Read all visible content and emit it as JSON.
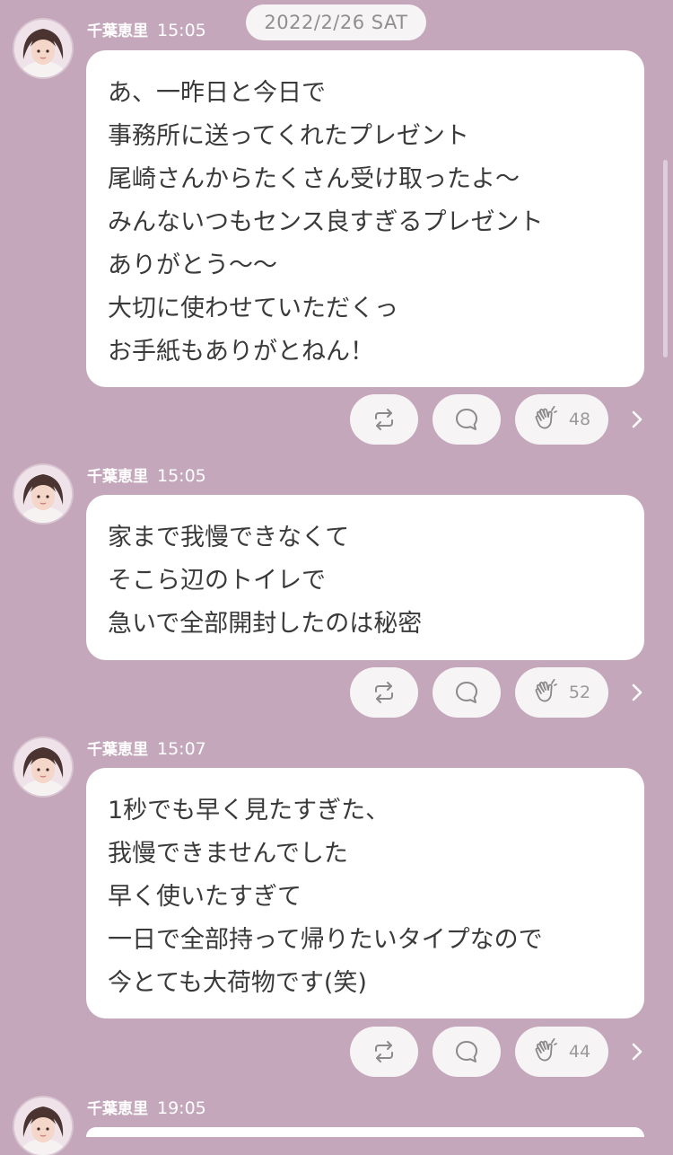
{
  "date_label": "2022/2/26 SAT",
  "messages": [
    {
      "author": "千葉恵里",
      "time": "15:05",
      "lines": [
        "あ、一昨日と今日で",
        "事務所に送ってくれたプレゼント",
        "尾崎さんからたくさん受け取ったよ〜",
        "みんないつもセンス良すぎるプレゼント",
        "ありがとう〜〜",
        "大切に使わせていただくっ",
        "お手紙もありがとねん！"
      ],
      "claps": "48"
    },
    {
      "author": "千葉恵里",
      "time": "15:05",
      "lines": [
        "家まで我慢できなくて",
        "そこら辺のトイレで",
        "急いで全部開封したのは秘密"
      ],
      "claps": "52"
    },
    {
      "author": "千葉恵里",
      "time": "15:07",
      "lines": [
        "1秒でも早く見たすぎた、",
        "我慢できませんでした",
        "早く使いたすぎて",
        "一日で全部持って帰りたいタイプなので",
        "今とても大荷物です(笑)"
      ],
      "claps": "44"
    },
    {
      "author": "千葉恵里",
      "time": "19:05",
      "lines": [],
      "claps": ""
    }
  ],
  "icons": {
    "share": "repost-icon",
    "comment": "comment-icon",
    "clap": "clap-hands-icon",
    "more": "chevron-right-icon",
    "avatar": "avatar"
  },
  "colors": {
    "background": "#c4a7bb",
    "bubble": "#ffffff",
    "pill": "#f7f4f6",
    "icon": "#8a8a8a"
  }
}
